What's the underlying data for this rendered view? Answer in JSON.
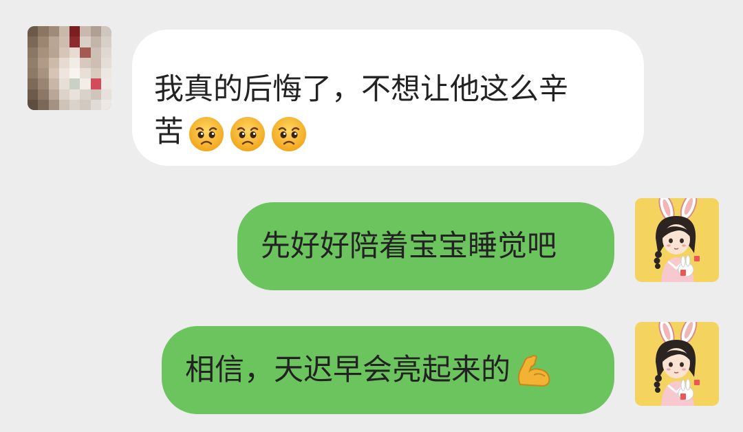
{
  "chat": {
    "messages": [
      {
        "side": "left",
        "line1": "我真的后悔了，不想让他这么辛",
        "line2": "苦",
        "emojis": [
          "pleading-face-icon",
          "pleading-face-icon",
          "pleading-face-icon"
        ]
      },
      {
        "side": "right",
        "text": "先好好陪着宝宝睡觉吧"
      },
      {
        "side": "right",
        "text": "相信，天迟早会亮起来的",
        "emoji": "flexed-biceps-icon"
      }
    ]
  },
  "colors": {
    "background": "#ededed",
    "incoming_bubble": "#ffffff",
    "outgoing_bubble": "#6cc45e",
    "right_avatar_bg": "#f4d35e"
  }
}
